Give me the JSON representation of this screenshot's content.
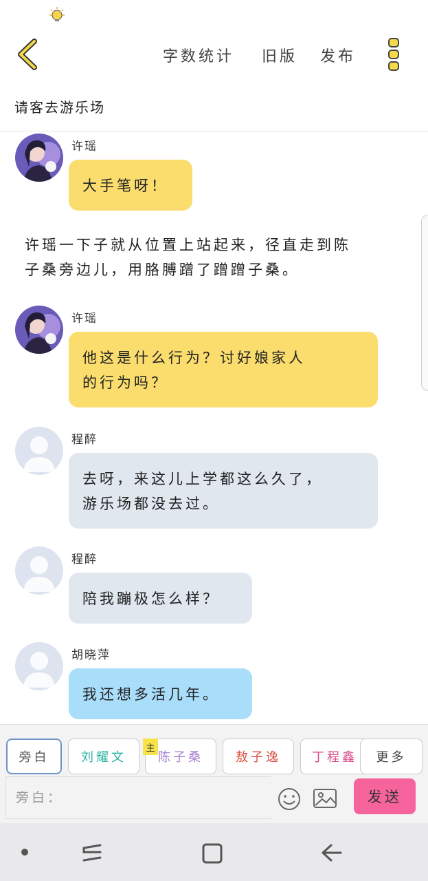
{
  "topbar": {
    "back_icon": "chevron-left-icon",
    "word_count_label": "字数统计",
    "old_version_label": "旧版",
    "publish_label": "发布",
    "more_icon": "vertical-dots-icon",
    "accent_color": "#f5d94a"
  },
  "chapter": {
    "title": "请客去游乐场"
  },
  "messages": [
    {
      "sender": "许瑶",
      "text": "大手笔呀！",
      "color": "#fbdd6e"
    },
    {
      "sender": "许瑶",
      "text_line1": "他这是什么行为？讨好娘家人",
      "text_line2": "的行为吗？",
      "color": "#fbdd6e"
    },
    {
      "sender": "程醉",
      "text_line1": "去呀，来这儿上学都这么久了，",
      "text_line2": "游乐场都没去过。",
      "color": "#e1e7ef"
    },
    {
      "sender": "程醉",
      "text": "陪我蹦极怎么样？",
      "color": "#e1e7ef"
    },
    {
      "sender": "胡晓萍",
      "text": "我还想多活几年。",
      "color": "#a9defb"
    }
  ],
  "narration": {
    "line1": "许瑶一下子就从位置上站起来，径直走到陈",
    "line2": "子桑旁边儿，用胳膊蹭了蹭蹭子桑。"
  },
  "roles": [
    {
      "label": "旁白",
      "color": "#555555",
      "selected": true
    },
    {
      "label": "刘耀文",
      "color": "#2bb3a3",
      "selected": false
    },
    {
      "label": "陈子桑",
      "color": "#a77fd1",
      "selected": false,
      "badge": "主"
    },
    {
      "label": "敖子逸",
      "color": "#d94b3f",
      "selected": false
    },
    {
      "label": "丁程鑫",
      "color": "#d94b8a",
      "selected": false
    },
    {
      "label": "更多",
      "color": "#444444",
      "selected": false
    }
  ],
  "input": {
    "placeholder": "旁白：",
    "value": ""
  },
  "send_label": "发送",
  "send_color": "#f7639c"
}
